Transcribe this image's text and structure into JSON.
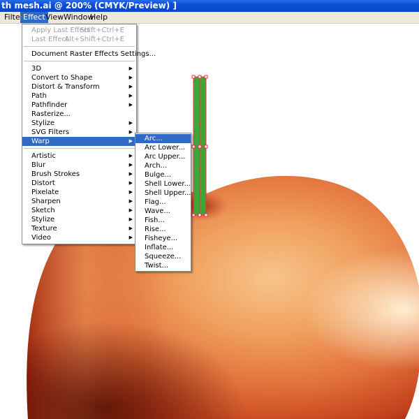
{
  "window": {
    "title": "th mesh.ai @ 200% (CMYK/Preview) ]"
  },
  "menubar": {
    "items": [
      {
        "label": "Filter"
      },
      {
        "label": "Effect"
      },
      {
        "label": "View"
      },
      {
        "label": "Window"
      },
      {
        "label": "Help"
      }
    ],
    "active": "Effect"
  },
  "effect_menu": {
    "apply_last": {
      "label": "Apply Last Effect",
      "shortcut": "Shift+Ctrl+E"
    },
    "last_effect": {
      "label": "Last Effect",
      "shortcut": "Alt+Shift+Ctrl+E"
    },
    "raster_settings": "Document Raster Effects Settings...",
    "illustrator_effects": [
      "3D",
      "Convert to Shape",
      "Distort & Transform",
      "Path",
      "Pathfinder",
      "Rasterize...",
      "Stylize",
      "SVG Filters",
      "Warp"
    ],
    "photoshop_effects": [
      "Artistic",
      "Blur",
      "Brush Strokes",
      "Distort",
      "Pixelate",
      "Sharpen",
      "Sketch",
      "Stylize",
      "Texture",
      "Video"
    ],
    "highlighted": "Warp"
  },
  "warp_submenu": {
    "items": [
      "Arc...",
      "Arc Lower...",
      "Arc Upper...",
      "Arch...",
      "Bulge...",
      "Shell Lower...",
      "Shell Upper...",
      "Flag...",
      "Wave...",
      "Fish...",
      "Rise...",
      "Fisheye...",
      "Inflate...",
      "Squeeze...",
      "Twist..."
    ],
    "highlighted": "Arc..."
  },
  "colors": {
    "title_bar": "#0a4fd8",
    "menu_highlight": "#316ac5",
    "apple_light": "#f7c48a",
    "apple_mid": "#e2703a",
    "apple_dark": "#8a1a08",
    "stem": "#3fa535",
    "selection": "#e8324a"
  }
}
